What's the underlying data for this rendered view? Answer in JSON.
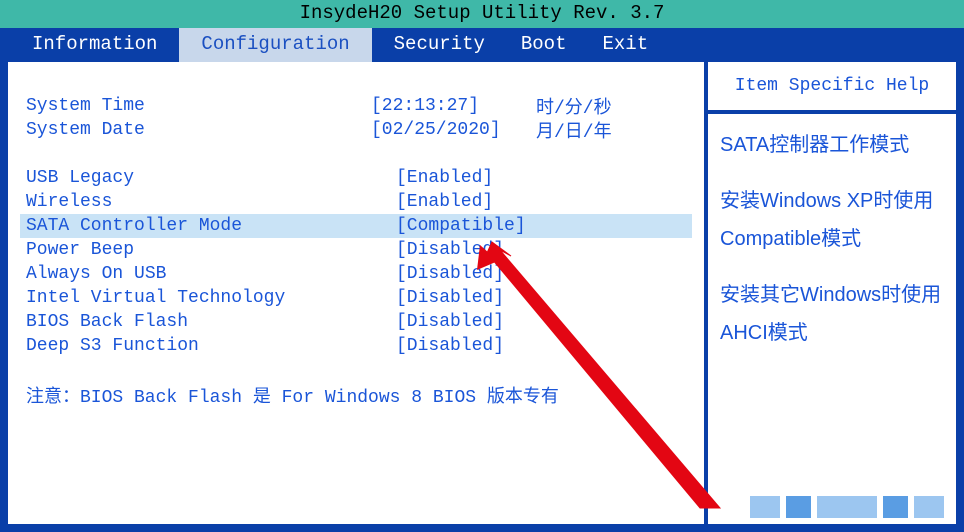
{
  "title": "InsydeH20 Setup Utility Rev. 3.7",
  "tabs": {
    "info": "Information",
    "config": "Configuration",
    "security": "Security",
    "boot": "Boot",
    "exit": "Exit"
  },
  "settings": {
    "system_time": {
      "label": "System Time",
      "value": "[22:13:27]",
      "extra": "时/分/秒"
    },
    "system_date": {
      "label": "System Date",
      "value": "[02/25/2020]",
      "extra": "月/日/年"
    },
    "usb_legacy": {
      "label": "USB Legacy",
      "value": "[Enabled]"
    },
    "wireless": {
      "label": "Wireless",
      "value": "[Enabled]"
    },
    "sata_mode": {
      "label": "SATA Controller Mode",
      "value": "[Compatible]"
    },
    "power_beep": {
      "label": "Power Beep",
      "value": "[Disabled]"
    },
    "always_on_usb": {
      "label": "Always On USB",
      "value": "[Disabled]"
    },
    "ivt": {
      "label": "Intel Virtual Technology",
      "value": "[Disabled]"
    },
    "bios_back_flash": {
      "label": "BIOS Back Flash",
      "value": "[Disabled]"
    },
    "deep_s3": {
      "label": "Deep S3 Function",
      "value": "[Disabled]"
    }
  },
  "note": "注意：BIOS Back Flash 是 For Windows 8 BIOS 版本专有",
  "help": {
    "title": "Item Specific Help",
    "line1": "SATA控制器工作模式",
    "line2": "安装Windows XP时使用Compatible模式",
    "line3": "安装其它Windows时使用AHCI模式"
  }
}
